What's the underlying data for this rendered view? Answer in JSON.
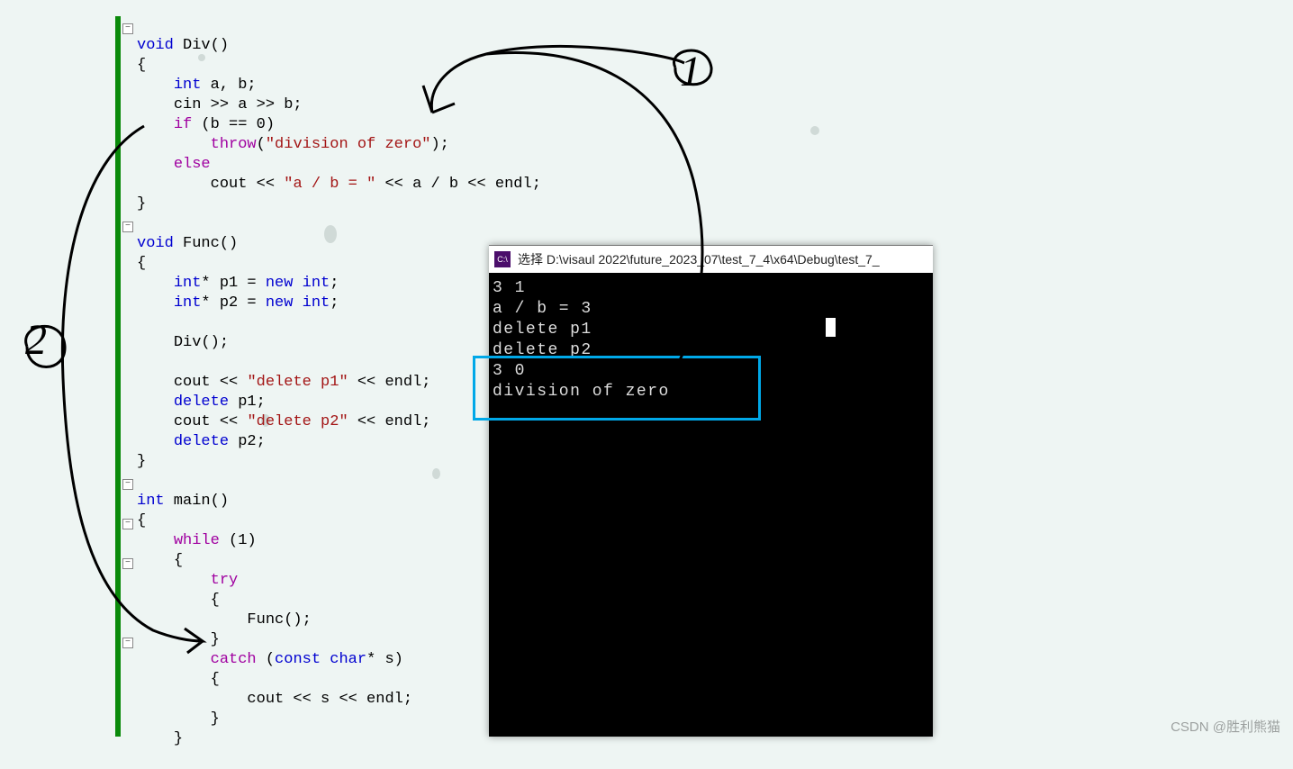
{
  "annotations": {
    "one": "1",
    "two": "2"
  },
  "watermark": "CSDN @胜利熊猫",
  "code": {
    "l1": {
      "kw1": "void",
      "id": " Div()"
    },
    "l2": "{",
    "l3": {
      "indent": "    ",
      "kw": "int",
      "rest": " a, b;"
    },
    "l4": {
      "indent": "    ",
      "a": "cin >> a >> b;"
    },
    "l5": {
      "indent": "    ",
      "kw": "if",
      "rest": " (b == ",
      "num": "0",
      "rest2": ")"
    },
    "l6": {
      "indent": "        ",
      "kw": "throw",
      "rest": "(",
      "str": "\"division of zero\"",
      "rest2": ");"
    },
    "l7": {
      "indent": "    ",
      "kw": "else"
    },
    "l8": {
      "indent": "        ",
      "a": "cout << ",
      "str": "\"a / b = \"",
      "b": " << a / b << endl;"
    },
    "l9": "}",
    "l10": "",
    "l11": {
      "kw1": "void",
      "id": " Func()"
    },
    "l12": "{",
    "l13": {
      "indent": "    ",
      "kw": "int",
      "rest": "* p1 = ",
      "kw2": "new",
      "rest2": " ",
      "kw3": "int",
      "rest3": ";"
    },
    "l14": {
      "indent": "    ",
      "kw": "int",
      "rest": "* p2 = ",
      "kw2": "new",
      "rest2": " ",
      "kw3": "int",
      "rest3": ";"
    },
    "l15": "",
    "l16": {
      "indent": "    ",
      "a": "Div();"
    },
    "l17": "",
    "l18": {
      "indent": "    ",
      "a": "cout << ",
      "str": "\"delete p1\"",
      "b": " << endl;"
    },
    "l19": {
      "indent": "    ",
      "kw": "delete",
      "rest": " p1;"
    },
    "l20": {
      "indent": "    ",
      "a": "cout << ",
      "str": "\"delete p2\"",
      "b": " << endl;"
    },
    "l21": {
      "indent": "    ",
      "kw": "delete",
      "rest": " p2;"
    },
    "l22": "}",
    "l23": "",
    "l24": {
      "kw1": "int",
      "id": " main()"
    },
    "l25": "{",
    "l26": {
      "indent": "    ",
      "kw": "while",
      "rest": " (",
      "num": "1",
      "rest2": ")"
    },
    "l27": {
      "indent": "    ",
      "a": "{"
    },
    "l28": {
      "indent": "        ",
      "kw": "try"
    },
    "l29": {
      "indent": "        ",
      "a": "{"
    },
    "l30": {
      "indent": "            ",
      "a": "Func();"
    },
    "l31": {
      "indent": "        ",
      "a": "}"
    },
    "l32": {
      "indent": "        ",
      "kw": "catch",
      "rest": " (",
      "kw2": "const",
      "rest2": " ",
      "kw3": "char",
      "rest3": "* s)"
    },
    "l33": {
      "indent": "        ",
      "a": "{"
    },
    "l34": {
      "indent": "            ",
      "a": "cout << s << endl;"
    },
    "l35": {
      "indent": "        ",
      "a": "}"
    },
    "l36": {
      "indent": "    ",
      "a": "}"
    }
  },
  "console": {
    "title": "选择 D:\\visaul 2022\\future_2023_07\\test_7_4\\x64\\Debug\\test_7_",
    "lines": [
      "3 1",
      "a / b = 3",
      "delete p1",
      "delete p2",
      "3 0",
      "division of zero"
    ]
  }
}
